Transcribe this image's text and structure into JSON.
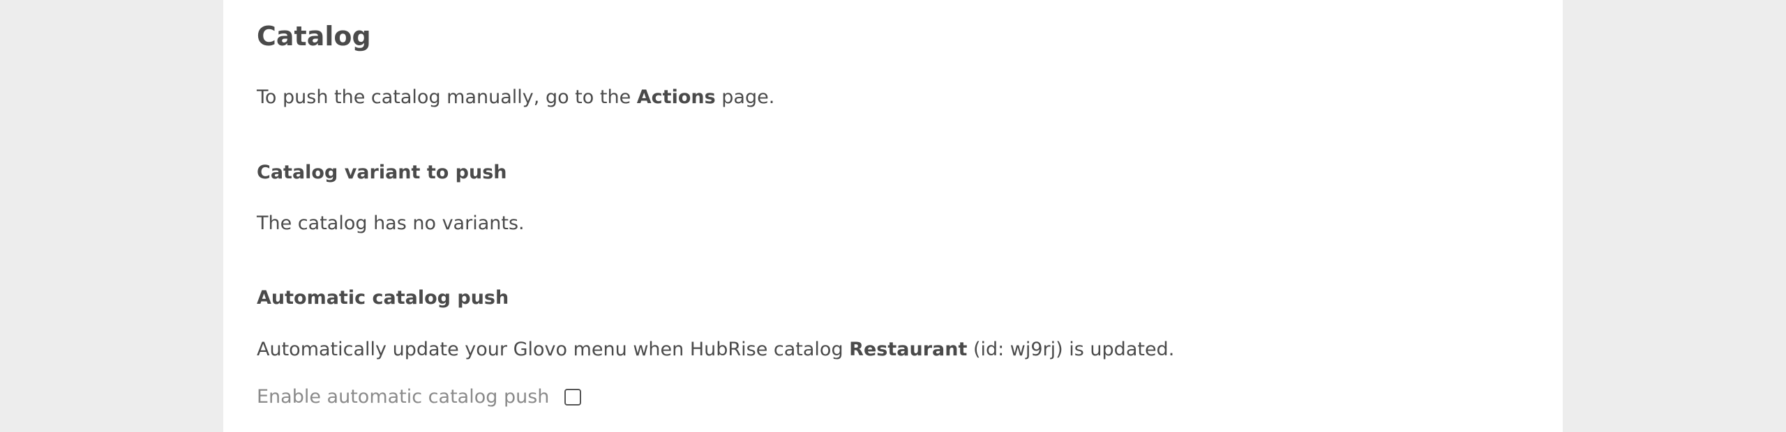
{
  "catalog": {
    "title": "Catalog",
    "intro": {
      "prefix": "To push the catalog manually, go to the ",
      "link_text": "Actions",
      "suffix": " page."
    },
    "variant_section": {
      "heading": "Catalog variant to push",
      "message": "The catalog has no variants."
    },
    "auto_push_section": {
      "heading": "Automatic catalog push",
      "description_prefix": "Automatically update your Glovo menu when HubRise catalog ",
      "catalog_name": "Restaurant",
      "description_suffix": " (id: wj9rj) is updated.",
      "checkbox_label": "Enable automatic catalog push",
      "checkbox_checked": false
    }
  }
}
